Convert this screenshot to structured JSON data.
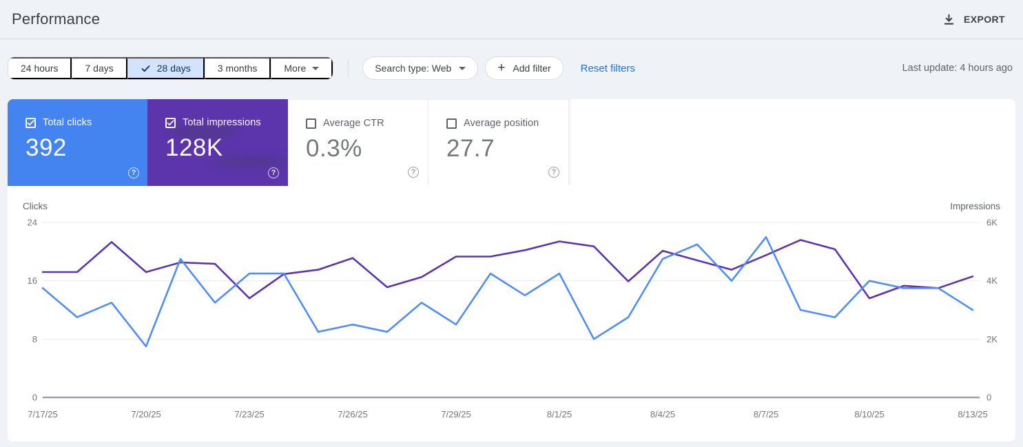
{
  "header": {
    "title": "Performance",
    "export_label": "EXPORT",
    "export_icon": "download-icon"
  },
  "filters": {
    "date_ranges": [
      {
        "label": "24 hours",
        "selected": false
      },
      {
        "label": "7 days",
        "selected": false
      },
      {
        "label": "28 days",
        "selected": true,
        "icon": "check-icon"
      },
      {
        "label": "3 months",
        "selected": false
      },
      {
        "label": "More",
        "selected": false,
        "icon": "caret-down-icon"
      }
    ],
    "search_type_label": "Search type: Web",
    "add_filter_label": "Add filter",
    "add_filter_icon": "plus-icon",
    "reset_filters_label": "Reset filters",
    "last_update": "Last update: 4 hours ago"
  },
  "metrics": [
    {
      "label": "Total clicks",
      "value": "392",
      "checked": true,
      "color": "#4484f0"
    },
    {
      "label": "Total impressions",
      "value": "128K",
      "checked": true,
      "color": "#5c35ad"
    },
    {
      "label": "Average CTR",
      "value": "0.3%",
      "checked": false,
      "color": "#ffffff"
    },
    {
      "label": "Average position",
      "value": "27.7",
      "checked": false,
      "color": "#ffffff"
    }
  ],
  "colors": {
    "link_blue": "#1a73e8",
    "selected_chip_bg": "#d3e3fd",
    "selected_chip_text": "#16325c",
    "page_background": "#eff2f6",
    "panel_background": "#ffffff"
  },
  "chart_data": {
    "type": "line",
    "x": [
      "7/17/25",
      "7/18/25",
      "7/19/25",
      "7/20/25",
      "7/21/25",
      "7/22/25",
      "7/23/25",
      "7/24/25",
      "7/25/25",
      "7/26/25",
      "7/27/25",
      "7/28/25",
      "7/29/25",
      "7/30/25",
      "7/31/25",
      "8/1/25",
      "8/2/25",
      "8/3/25",
      "8/4/25",
      "8/5/25",
      "8/6/25",
      "8/7/25",
      "8/8/25",
      "8/9/25",
      "8/10/25",
      "8/11/25",
      "8/12/25",
      "8/13/25"
    ],
    "x_label_every": 3,
    "x_tick_labels": [
      "7/17/25",
      "7/20/25",
      "7/23/25",
      "7/26/25",
      "7/29/25",
      "8/1/25",
      "8/4/25",
      "8/7/25",
      "8/10/25",
      "8/13/25"
    ],
    "series": [
      {
        "name": "Clicks",
        "axis": "left",
        "color": "#4f8ef7",
        "values": [
          15,
          11,
          13,
          7,
          19,
          13,
          17,
          17,
          9,
          10,
          9,
          13,
          10,
          17,
          14,
          17,
          8,
          11,
          19,
          21,
          16,
          22,
          12,
          11,
          16,
          15,
          15,
          12
        ]
      },
      {
        "name": "Impressions",
        "axis": "right",
        "color": "#5c33b3",
        "values": [
          4300,
          4300,
          5330,
          4300,
          4630,
          4580,
          3400,
          4230,
          4380,
          4780,
          3780,
          4130,
          4830,
          4830,
          5050,
          5350,
          5180,
          3980,
          5030,
          4700,
          4380,
          4880,
          5400,
          5080,
          3400,
          3830,
          3750,
          4150
        ]
      }
    ],
    "left_axis": {
      "label": "Clicks",
      "max": 24,
      "ticks": [
        24,
        16,
        8,
        0
      ],
      "tick_labels": [
        "24",
        "16",
        "8",
        "0"
      ]
    },
    "right_axis": {
      "label": "Impressions",
      "max": 6000,
      "ticks": [
        6000,
        4000,
        2000,
        0
      ],
      "tick_labels": [
        "6K",
        "4K",
        "2K",
        "0"
      ]
    },
    "grid": true,
    "legend_position": "none"
  }
}
